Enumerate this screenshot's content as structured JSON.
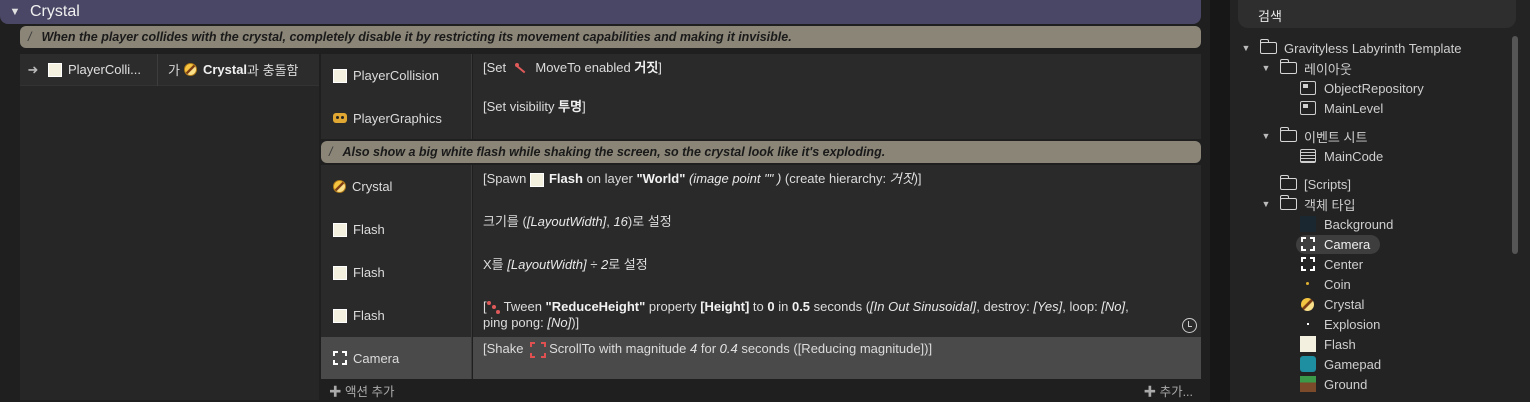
{
  "sheet": {
    "group": {
      "toggle": "▼",
      "title": "Crystal"
    },
    "comment1": {
      "slash": "/",
      "text": "When the player collides with the crystal, completely disable it by restricting its movement capabilities and making it invisible."
    },
    "condition": {
      "arrow": "➜",
      "object": "PlayerColli...",
      "prefix": "가",
      "target": "Crystal",
      "suffix": "과 충돌함"
    },
    "actions1": [
      {
        "object": "PlayerCollision",
        "icon": "white-square",
        "text_a": "[Set ",
        "text_b": " MoveTo enabled ",
        "text_c": "거짓",
        "text_d": "]"
      },
      {
        "object": "PlayerGraphics",
        "icon": "mask",
        "text_a": "[Set visibility ",
        "text_b": "투명",
        "text_c": "]"
      }
    ],
    "comment2": {
      "slash": "/",
      "text": "Also show a big white flash while shaking the screen, so the crystal look like it's exploding."
    },
    "actions2": [
      {
        "object": "Crystal",
        "t1": "[Spawn ",
        "t2": "Flash",
        "t3": " on layer ",
        "t4": "\"World\"",
        "t5": " (image point \"\" )",
        "t6": " (create hierarchy: ",
        "t7": "거짓",
        "t8": ")]"
      },
      {
        "object": "Flash",
        "t1": "크기를 (",
        "t2": "[LayoutWidth]",
        "t3": ", ",
        "t4": "16",
        "t5": ")로 설정"
      },
      {
        "object": "Flash",
        "t1": "X를 ",
        "t2": "[LayoutWidth] ÷ 2",
        "t3": "로 설정"
      },
      {
        "object": "Flash",
        "t1": "[",
        "t2": "Tween ",
        "t3": "\"ReduceHeight\"",
        "t4": " property ",
        "t5": "[Height]",
        "t6": " to ",
        "t7": "0",
        "t8": " in ",
        "t9": "0.5",
        "t10": " seconds (",
        "t11": "[In Out Sinusoidal]",
        "t12": ", destroy: ",
        "t13": "[Yes]",
        "t14": ", loop: ",
        "t15": "[No]",
        "t16": ",",
        "t17": "ping pong: ",
        "t18": "[No]",
        "t19": ")]"
      },
      {
        "object": "Camera",
        "t1": "[Shake ",
        "t2": "ScrollTo with magnitude ",
        "t3": "4",
        "t4": " for ",
        "t5": "0.4",
        "t6": " seconds ([Reducing magnitude])]"
      }
    ],
    "footer": {
      "add_action": "✚ 액션 추가",
      "add_more": "✚ 추가..."
    }
  },
  "project": {
    "search_label": "검색",
    "root": "Gravityless Labyrinth Template",
    "layouts_folder": "레이아웃",
    "layouts": [
      "ObjectRepository",
      "MainLevel"
    ],
    "eventsheets_folder": "이벤트 시트",
    "eventsheets": [
      "MainCode"
    ],
    "scripts_folder": "[Scripts]",
    "objecttypes_folder": "객체 타입",
    "objecttypes": [
      "Background",
      "Camera",
      "Center",
      "Coin",
      "Crystal",
      "Explosion",
      "Flash",
      "Gamepad",
      "Ground"
    ]
  }
}
